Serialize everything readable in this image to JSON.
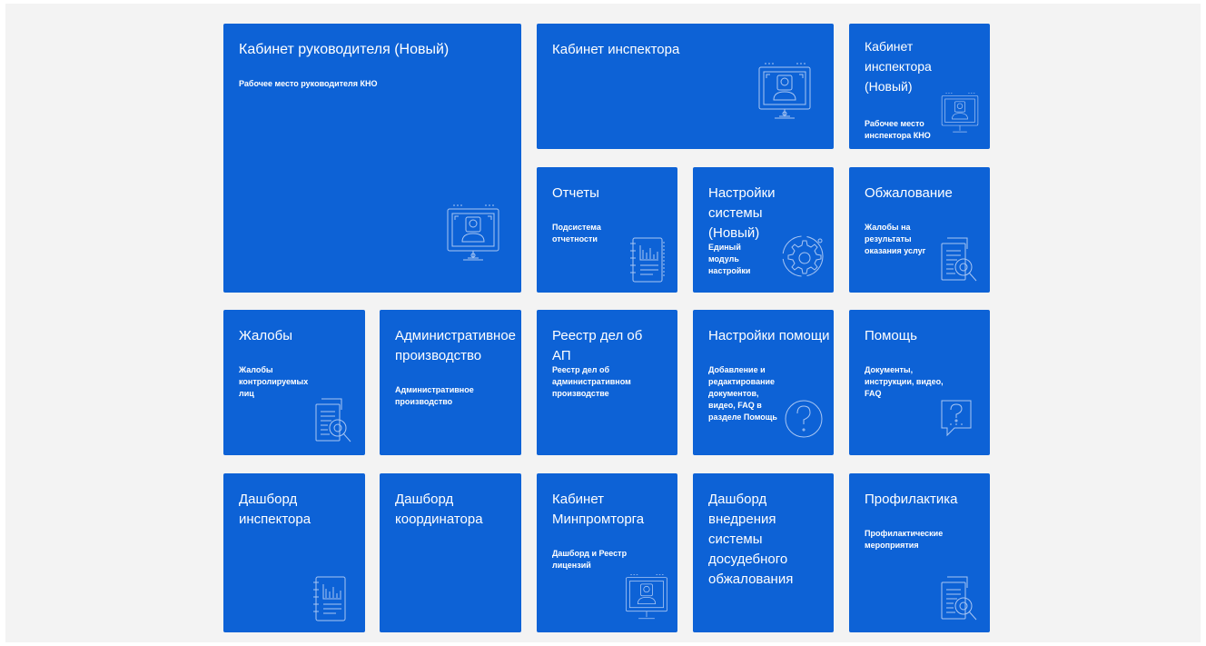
{
  "colors": {
    "tile": "#0d62d6",
    "background": "#f3f3f3",
    "icon": "#a9c6f3"
  },
  "tiles": [
    {
      "id": "kabinet-rukovoditelya",
      "title": "Кабинет руководителя (Новый)",
      "desc": "Рабочее место руководителя КНО",
      "icon": "monitor-person-icon"
    },
    {
      "id": "kabinet-inspektora",
      "title": "Кабинет инспектора",
      "desc": "",
      "icon": "monitor-person-icon"
    },
    {
      "id": "kabinet-inspektora-new",
      "title": "Кабинет инспектора (Новый)",
      "desc": "Рабочее место инспектора КНО",
      "icon": "monitor-person-icon"
    },
    {
      "id": "otchety",
      "title": "Отчеты",
      "desc": "Подсистема отчетности",
      "icon": "report-chart-icon"
    },
    {
      "id": "nastroyki-sistemy",
      "title": "Настройки системы (Новый)",
      "desc": "Единый модуль настройки",
      "icon": "gear-icon"
    },
    {
      "id": "obzhalovanie",
      "title": "Обжалование",
      "desc": "Жалобы на результаты оказания услуг",
      "icon": "document-search-icon"
    },
    {
      "id": "zhaloby",
      "title": "Жалобы",
      "desc": "Жалобы контролируемых лиц",
      "icon": "document-search-icon"
    },
    {
      "id": "admin-proizvodstvo",
      "title": "Административное производство",
      "desc": "Административное производство",
      "icon": ""
    },
    {
      "id": "reestr-del",
      "title": "Реестр дел об АП",
      "desc": "Реестр дел об административном производстве",
      "icon": ""
    },
    {
      "id": "nastroyki-pomoshchi",
      "title": "Настройки помощи",
      "desc": "Добавление и редактирование документов, видео, FAQ в разделе Помощь",
      "icon": "question-circle-icon"
    },
    {
      "id": "pomoshch",
      "title": "Помощь",
      "desc": "Документы, инструкции, видео, FAQ",
      "icon": "question-chat-icon"
    },
    {
      "id": "dashbord-inspektora",
      "title": "Дашборд инспектора",
      "desc": "",
      "icon": "report-chart-icon"
    },
    {
      "id": "dashbord-koordinatora",
      "title": "Дашборд координатора",
      "desc": "",
      "icon": ""
    },
    {
      "id": "kabinet-minpromtorga",
      "title": "Кабинет Минпромторга",
      "desc": "Дашборд и Реестр лицензий",
      "icon": "monitor-person-icon"
    },
    {
      "id": "dashbord-vnedreniya",
      "title": "Дашборд внедрения системы досудебного обжалования",
      "desc": "",
      "icon": ""
    },
    {
      "id": "profilaktika",
      "title": "Профилактика",
      "desc": "Профилактические мероприятия",
      "icon": "document-search-icon"
    }
  ]
}
